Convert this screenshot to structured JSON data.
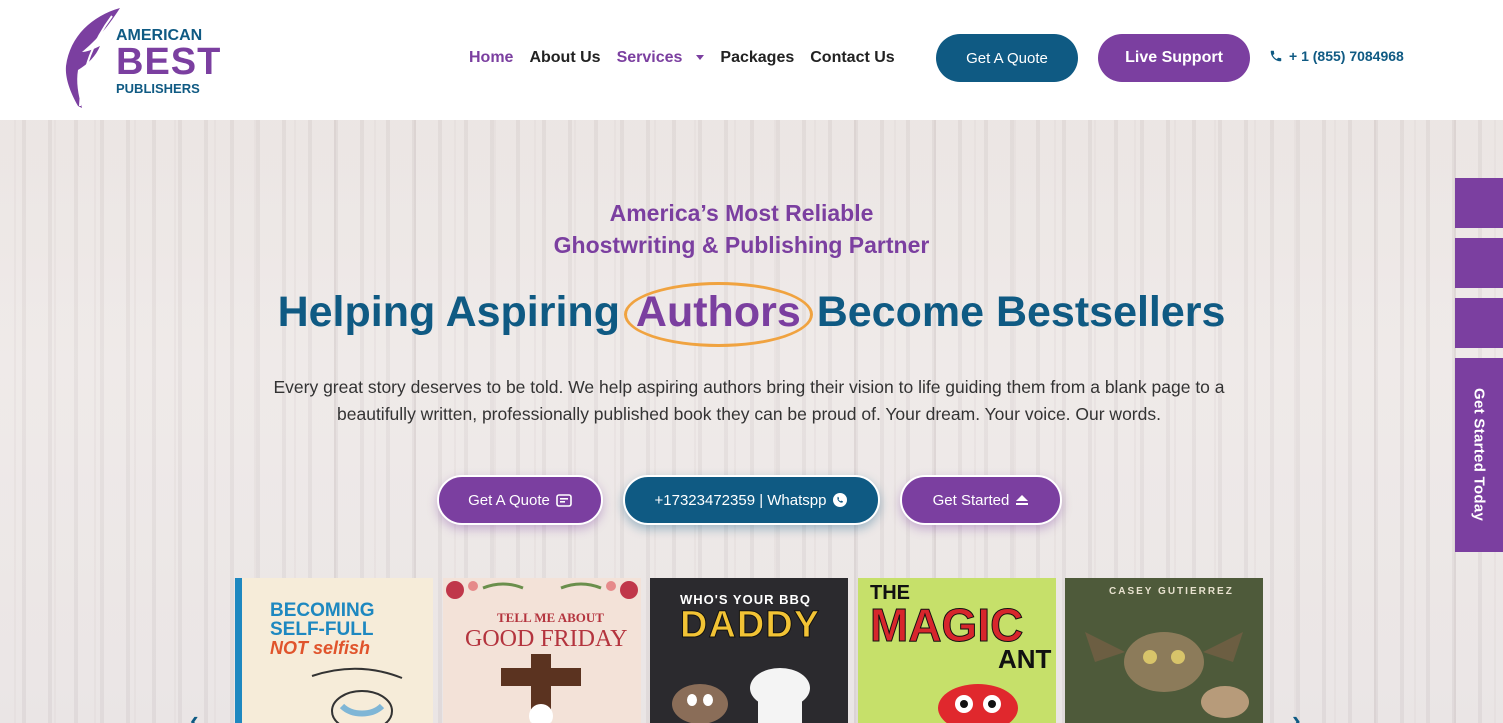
{
  "brand": {
    "line1": "AMERICAN",
    "line2": "BEST",
    "line3": "PUBLISHERS"
  },
  "nav": {
    "items": [
      "Home",
      "About Us",
      "Services",
      "Packages",
      "Contact Us"
    ],
    "active": "Home"
  },
  "header": {
    "quote_button": "Get A Quote",
    "live_support_button": "Live Support",
    "phone": "+ 1 (855) 7084968"
  },
  "hero": {
    "subtitle_line1": "America’s Most Reliable",
    "subtitle_line2": "Ghostwriting & Publishing Partner",
    "headline_pre": "Helping Aspiring",
    "headline_accent": "Authors",
    "headline_post": "Become Bestsellers",
    "description": "Every great story deserves to be told. We help aspiring authors bring their vision to life guiding them from a blank page to a beautifully written, professionally published book they can be proud of. Your dream. Your voice. Our words.",
    "buttons": {
      "quote": "Get A Quote",
      "whatsapp": "+17323472359 | Whatspp",
      "get_started": "Get Started"
    }
  },
  "side": {
    "get_started_today": "Get Started Today"
  },
  "books": [
    {
      "title_line1": "BECOMING",
      "title_line2": "SELF-FULL",
      "title_line3": "NOT selfish"
    },
    {
      "title_line1": "TELL ME ABOUT",
      "title_line2": "GOOD FRIDAY"
    },
    {
      "title_line1": "WHO'S YOUR BBQ",
      "title_line2": "DADDY"
    },
    {
      "title_line1": "THE",
      "title_line2": "MAGIC",
      "title_line3": "ANT"
    },
    {
      "author": "CASEY GUTIERREZ"
    }
  ],
  "colors": {
    "purple": "#7b3fa0",
    "blue": "#0f5a83",
    "accent_orange": "#f0a340"
  }
}
